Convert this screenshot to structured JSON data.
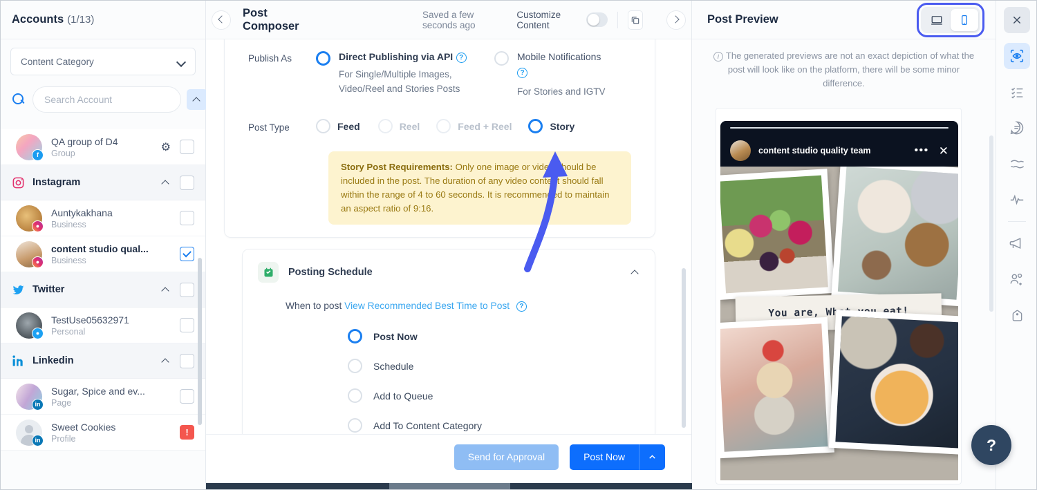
{
  "sidebar": {
    "title": "Accounts",
    "count": "(1/13)",
    "category_label": "Content Category",
    "search_placeholder": "Search Account",
    "groups": [
      {
        "name": "QA group of D4",
        "type": "Group",
        "network": "facebook",
        "is_account_row": true
      },
      {
        "name": "Instagram",
        "network": "instagram",
        "is_account_row": false,
        "accounts": [
          {
            "name": "Auntykakhana",
            "type": "Business",
            "selected": false,
            "alert": false
          },
          {
            "name": "content studio qual...",
            "type": "Business",
            "selected": true,
            "alert": false
          }
        ]
      },
      {
        "name": "Twitter",
        "network": "twitter",
        "is_account_row": false,
        "accounts": [
          {
            "name": "TestUse05632971",
            "type": "Personal",
            "selected": false,
            "alert": false
          }
        ]
      },
      {
        "name": "Linkedin",
        "network": "linkedin",
        "is_account_row": false,
        "accounts": [
          {
            "name": "Sugar, Spice and ev...",
            "type": "Page",
            "selected": false,
            "alert": false
          },
          {
            "name": "Sweet Cookies",
            "type": "Profile",
            "selected": false,
            "alert": true
          }
        ]
      }
    ]
  },
  "composer": {
    "title": "Post Composer",
    "saved_status": "Saved a few seconds ago",
    "customize_label": "Customize Content",
    "customize_on": false,
    "publish_as": {
      "label": "Publish As",
      "options": [
        {
          "title": "Direct Publishing via API",
          "subtitle": "For Single/Multiple Images, Video/Reel and Stories Posts",
          "selected": true,
          "has_help": true
        },
        {
          "title": "Mobile Notifications",
          "subtitle": "For Stories and IGTV",
          "selected": false,
          "has_help": true
        }
      ]
    },
    "post_type": {
      "label": "Post Type",
      "options": [
        {
          "label": "Feed",
          "selected": false,
          "disabled": false
        },
        {
          "label": "Reel",
          "selected": false,
          "disabled": true
        },
        {
          "label": "Feed + Reel",
          "selected": false,
          "disabled": true
        },
        {
          "label": "Story",
          "selected": true,
          "disabled": false
        }
      ]
    },
    "warning": {
      "heading": "Story Post Requirements:",
      "body": " Only one image or video should be included in the post. The duration of any video content should fall within the range of 4 to 60 seconds. It is recommended to maintain an aspect ratio of 9:16."
    },
    "posting_schedule": {
      "title": "Posting Schedule",
      "when_label": "When to post",
      "best_time_link": "View Recommended Best Time to Post",
      "options": [
        {
          "label": "Post Now",
          "selected": true
        },
        {
          "label": "Schedule",
          "selected": false
        },
        {
          "label": "Add to Queue",
          "selected": false
        },
        {
          "label": "Add To Content Category",
          "selected": false
        }
      ]
    },
    "footer": {
      "secondary_button": "Send for Approval",
      "primary_button": "Post Now"
    }
  },
  "preview": {
    "title": "Post Preview",
    "devices": [
      {
        "name": "desktop",
        "active": false
      },
      {
        "name": "mobile",
        "active": true
      }
    ],
    "note": "The generated previews are not an exact depiction of what the post will look like on the platform, there will be some minor difference.",
    "story": {
      "account_name": "content studio quality team",
      "caption_text": "You are, What you eat!"
    }
  },
  "rail": {
    "items": [
      {
        "icon": "close-icon",
        "active": false
      },
      {
        "icon": "preview-eye-icon",
        "active": true
      },
      {
        "icon": "checklist-icon",
        "active": false
      },
      {
        "icon": "comment-icon",
        "active": false
      },
      {
        "icon": "approval-hands-icon",
        "active": false
      },
      {
        "icon": "activity-icon",
        "active": false
      },
      {
        "icon": "megaphone-icon",
        "active": false
      },
      {
        "icon": "add-people-icon",
        "active": false
      },
      {
        "icon": "tag-icon",
        "active": false
      }
    ]
  },
  "help_button": {
    "label": "?"
  },
  "colors": {
    "accent_blue": "#0d6efd",
    "link_blue": "#3aa7f0",
    "warning_bg": "#fdf3cf",
    "warning_text": "#9a7a13",
    "highlight_outline": "#4a5bf0",
    "alert_red": "#f4564e",
    "annotation_arrow": "#4a5bf0"
  }
}
